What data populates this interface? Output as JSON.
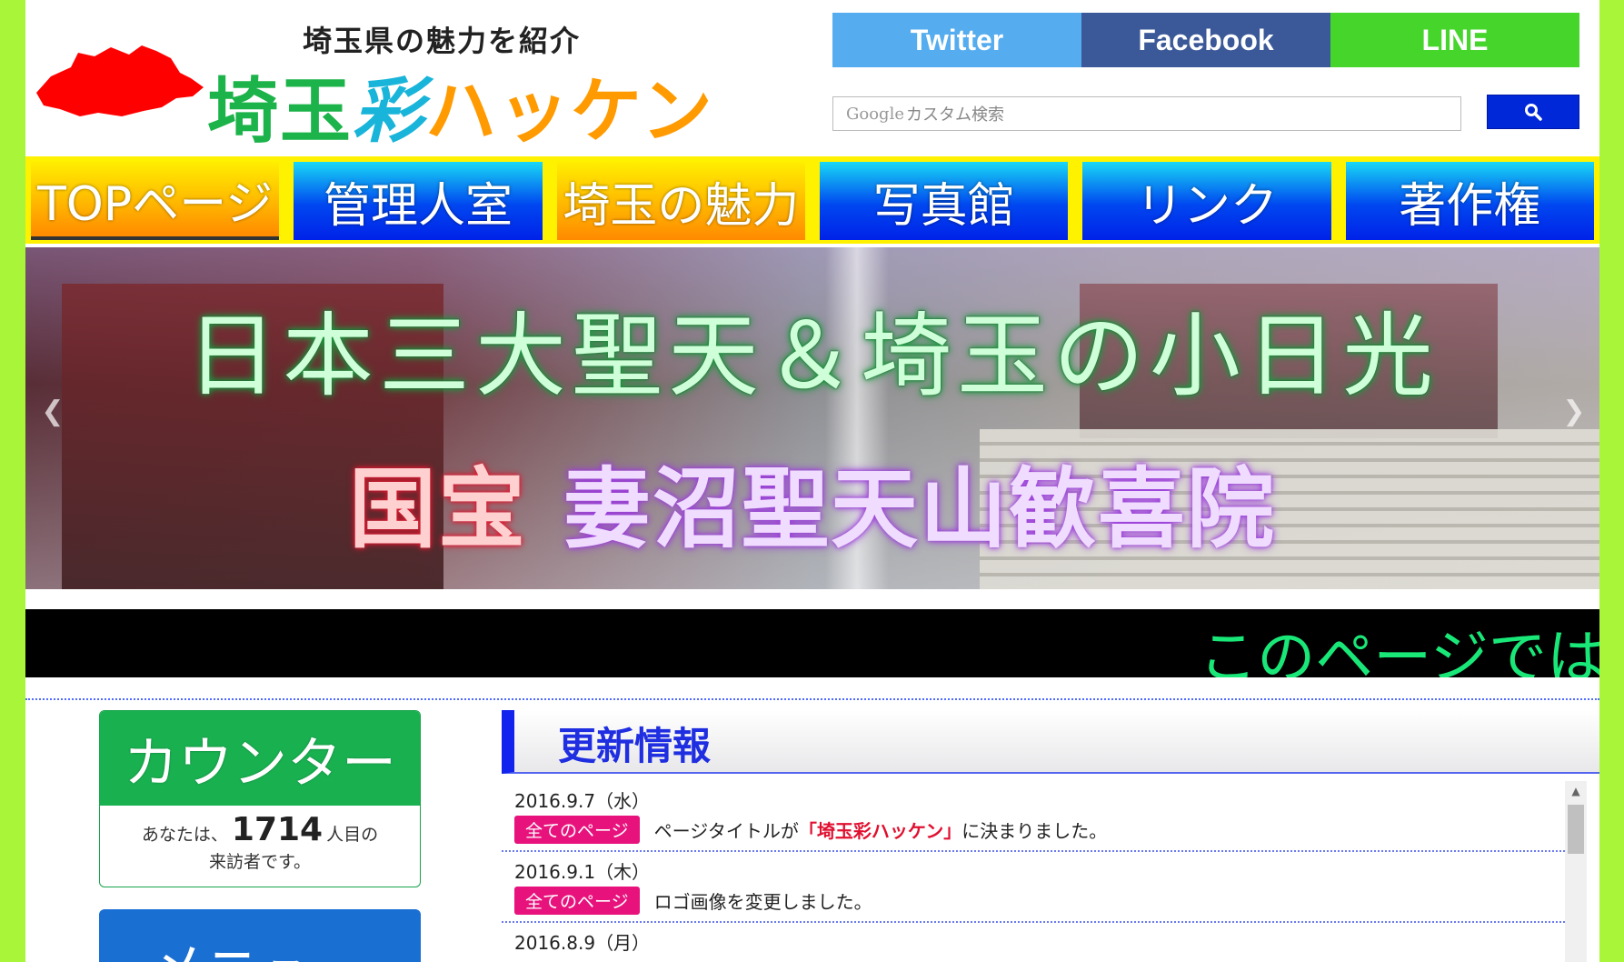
{
  "header": {
    "tagline": "埼玉県の魅力を紹介",
    "site_title_1": "埼玉",
    "site_title_2": "彩",
    "site_title_3": "ハッケン"
  },
  "share": {
    "twitter": "Twitter",
    "facebook": "Facebook",
    "line": "LINE"
  },
  "search": {
    "google_label": "Google",
    "placeholder": "カスタム検索"
  },
  "nav": {
    "items": [
      "TOPページ",
      "管理人室",
      "埼玉の魅力",
      "写真館",
      "リンク",
      "著作権"
    ]
  },
  "hero": {
    "title_line1": "日本三大聖天＆埼玉の小日光",
    "title_red": "国宝",
    "title_purple": "妻沼聖天山歓喜院"
  },
  "ticker": {
    "text": "このページでは"
  },
  "counter": {
    "title": "カウンター",
    "prefix": "あなたは、",
    "count": "1714",
    "suffix": "人目の",
    "line2": "来訪者です。"
  },
  "menu_widget": {
    "title": "メニュー"
  },
  "updates": {
    "title": "更新情報",
    "items": [
      {
        "date": "2016.9.7（水）",
        "tag": "全てのページ",
        "text_before": "ページタイトルが",
        "text_emph": "「埼玉彩ハッケン」",
        "text_after": "に決まりました。"
      },
      {
        "date": "2016.9.1（木）",
        "tag": "全てのページ",
        "text": "ロゴ画像を変更しました。"
      },
      {
        "date": "2016.8.9（月）"
      }
    ]
  },
  "colors": {
    "page_border": "#a8f53a",
    "twitter": "#55acee",
    "facebook": "#3b5998",
    "line": "#46d52b",
    "nav_bar": "#fff200",
    "counter_green": "#19b050",
    "tag_pink": "#e8127d",
    "section_blue": "#1223ee"
  }
}
